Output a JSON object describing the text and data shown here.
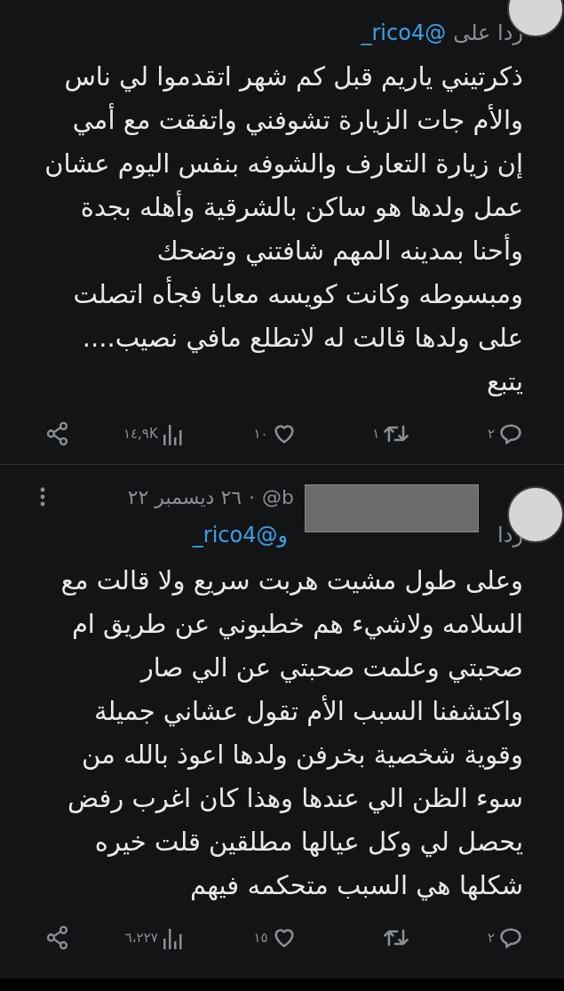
{
  "tweets": [
    {
      "reply_to": {
        "prefix": "ردا على",
        "mention": "@rico4_",
        "redacted": false
      },
      "text": "ذكرتيني ياريم قبل كم شهر اتقدموا لي ناس\nوالأم جات الزيارة تشوفني واتفقت مع أمي\nإن زيارة التعارف والشوفه بنفس اليوم عشان\nعمل ولدها هو ساكن بالشرقية وأهله بجدة\nوأحنا بمدينه المهم شافتني وتضحك\nومبسوطه وكانت كويسه معايا فجأه اتصلت\nعلى ولدها قالت له لاتطلع مافي نصيب....\nيتبع",
      "actions": {
        "replies": "٢",
        "retweets": "١",
        "likes": "١٠",
        "views": "١٤,٩K"
      }
    },
    {
      "header": {
        "handle": "@b",
        "separator": "·",
        "date": "٢٦ ديسمبر ٢٢"
      },
      "reply_to": {
        "prefix": "ردا",
        "conjunction": "و",
        "mention": "@rico4_",
        "redacted": true
      },
      "text": "وعلى طول مشيت هربت سريع ولا قالت مع\nالسلامه ولاشيء هم خطبوني عن طريق ام\nصحبتي وعلمت صحبتي عن الي صار\nواكتشفنا السبب الأم تقول عشاني جميلة\nوقوية شخصية بخرفن ولدها اعوذ بالله من\nسوء الظن الي عندها وهذا كان اغرب رفض\nيحصل لي وكل عيالها مطلقين قلت خيره\nشكلها هي السبب متحكمه فيهم",
      "actions": {
        "replies": "٢",
        "likes": "١٥",
        "views": "٦،٢٢٧"
      }
    }
  ]
}
